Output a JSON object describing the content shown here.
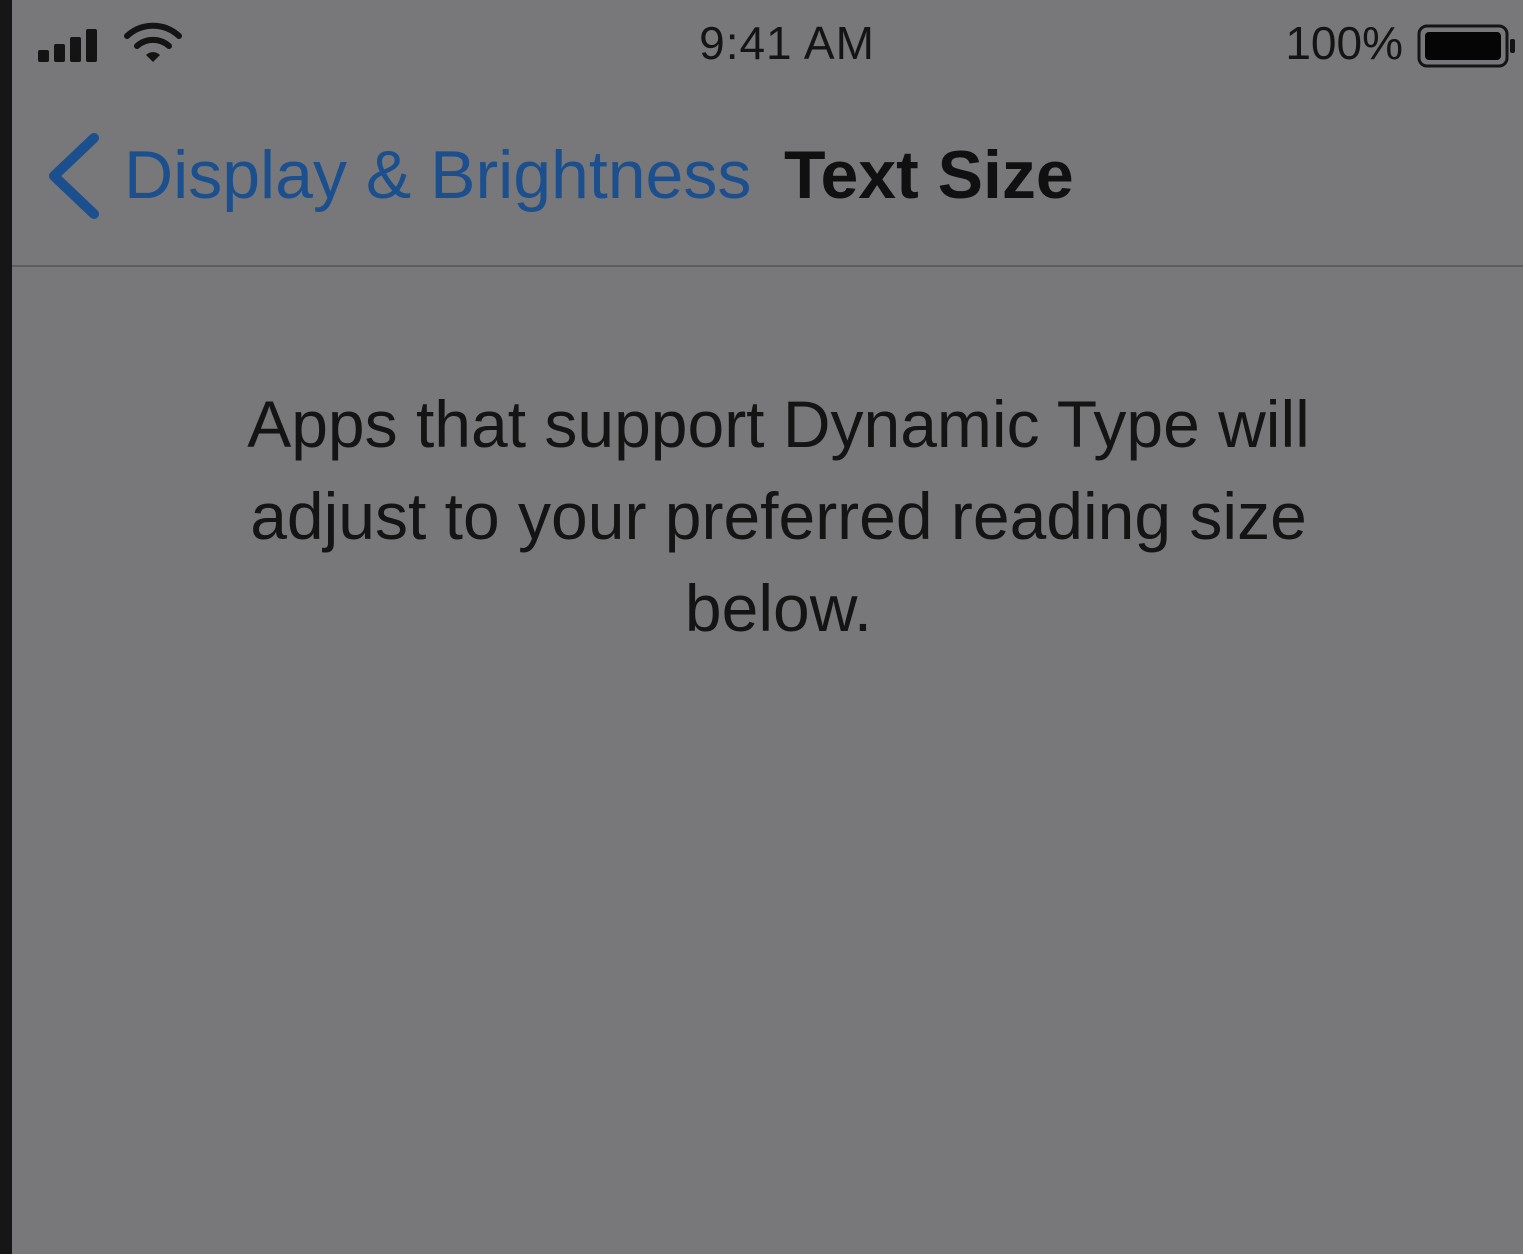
{
  "status_bar": {
    "time": "9:41 AM",
    "battery_percent": "100%",
    "signal_icon": "cellular-signal-icon",
    "wifi_icon": "wifi-icon",
    "battery_icon": "battery-icon",
    "battery_level": 1.0
  },
  "nav": {
    "back_icon": "chevron-left-icon",
    "back_label": "Display & Brightness",
    "title": "Text Size"
  },
  "content": {
    "description": "Apps that support Dynamic Type will adjust to your preferred reading size below."
  },
  "colors": {
    "background": "#78787a",
    "accent": "#1b4f8e",
    "text": "#141414"
  }
}
